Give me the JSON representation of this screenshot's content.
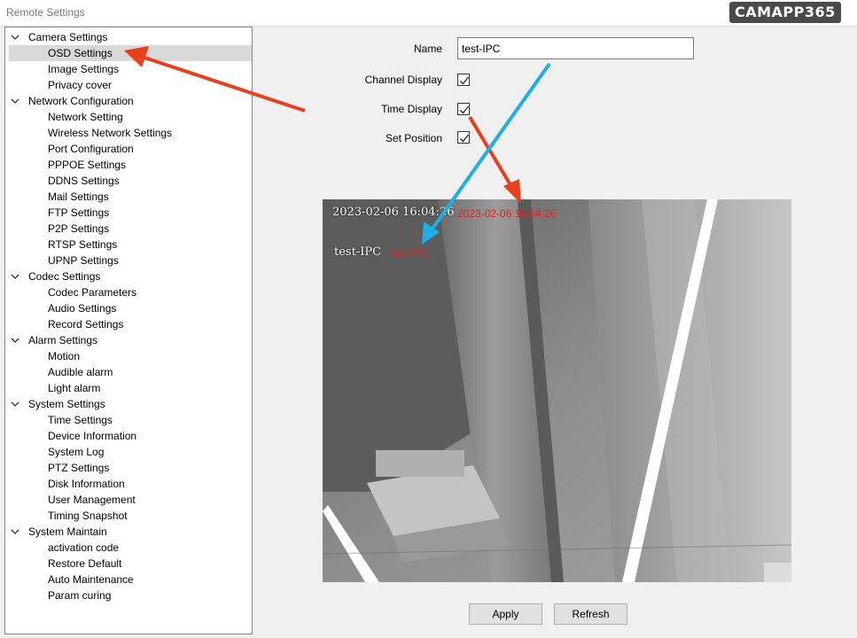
{
  "window": {
    "title": "Remote Settings",
    "brand": "CAMAPP365"
  },
  "tree": [
    {
      "label": "Camera Settings",
      "children": [
        "OSD Settings",
        "Image Settings",
        "Privacy cover"
      ]
    },
    {
      "label": "Network Configuration",
      "children": [
        "Network Setting",
        "Wireless Network Settings",
        "Port Configuration",
        "PPPOE Settings",
        "DDNS Settings",
        "Mail Settings",
        "FTP Settings",
        "P2P Settings",
        "RTSP Settings",
        "UPNP Settings"
      ]
    },
    {
      "label": "Codec Settings",
      "children": [
        "Codec Parameters",
        "Audio Settings",
        "Record Settings"
      ]
    },
    {
      "label": "Alarm Settings",
      "children": [
        "Motion",
        "Audible alarm",
        "Light alarm"
      ]
    },
    {
      "label": "System Settings",
      "children": [
        "Time Settings",
        "Device Information",
        "System Log",
        "PTZ Settings",
        "Disk Information",
        "User Management",
        "Timing Snapshot"
      ]
    },
    {
      "label": "System Maintain",
      "children": [
        "activation code",
        "Restore Default",
        "Auto Maintenance",
        "Param curing"
      ]
    }
  ],
  "tree_selected": "OSD Settings",
  "form": {
    "name_label": "Name",
    "name_value": "test-IPC",
    "channel_display_label": "Channel Display",
    "channel_display_checked": true,
    "time_display_label": "Time Display",
    "time_display_checked": true,
    "set_position_label": "Set Position",
    "set_position_checked": true
  },
  "preview": {
    "camera_time": "2023-02-06 16:04:26",
    "camera_name": "test-IPC",
    "osd_time": "2023-02-06 16:04:26",
    "osd_name": "test-IPC"
  },
  "buttons": {
    "apply": "Apply",
    "refresh": "Refresh"
  },
  "colors": {
    "annotation_red": "#e8401f",
    "annotation_blue": "#1eaee8",
    "osd_red": "#e3241b",
    "selection": "#d9d9d9"
  },
  "icons": {
    "expand": "chevron-down-icon",
    "check": "checkmark-icon"
  }
}
